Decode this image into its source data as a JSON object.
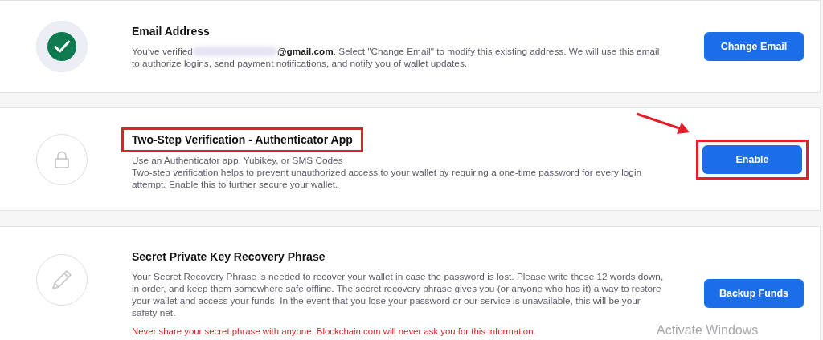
{
  "cards": [
    {
      "kind": "check",
      "title": "Email Address",
      "title_highlighted": false,
      "verified_prefix": "You've verified",
      "email_redacted": true,
      "description": [
        "**@gmail.com**. Select \"Change Email\" to modify this existing address. We will use this email to authorize logins, send payment notifications, and notify you of wallet updates."
      ],
      "button": {
        "label": "Change Email",
        "highlighted": false,
        "arrow": false
      }
    },
    {
      "kind": "lock",
      "title": "Two-Step Verification - Authenticator App",
      "title_highlighted": true,
      "description": [
        "Use an Authenticator app, Yubikey, or SMS Codes",
        "Two-step verification helps to prevent unauthorized access to your wallet by requiring a one-time password for every login attempt. Enable this to further secure your wallet."
      ],
      "button": {
        "label": "Enable",
        "highlighted": true,
        "arrow": true
      }
    },
    {
      "kind": "pencil",
      "title": "Secret Private Key Recovery Phrase",
      "title_highlighted": false,
      "description": [
        "Your Secret Recovery Phrase is needed to recover your wallet in case the password is lost. Please write these 12 words down, in order, and keep them somewhere safe offline. The secret recovery phrase gives you (or anyone who has it) a way to restore your wallet and access your funds. In the event that you lose your password or our service is unavailable, this will be your safety net."
      ],
      "warning": "Never share your secret phrase with anyone. Blockchain.com will never ask you for this information.",
      "button": {
        "label": "Backup Funds",
        "highlighted": false,
        "arrow": false
      }
    }
  ],
  "os_notice": "Activate Windows"
}
